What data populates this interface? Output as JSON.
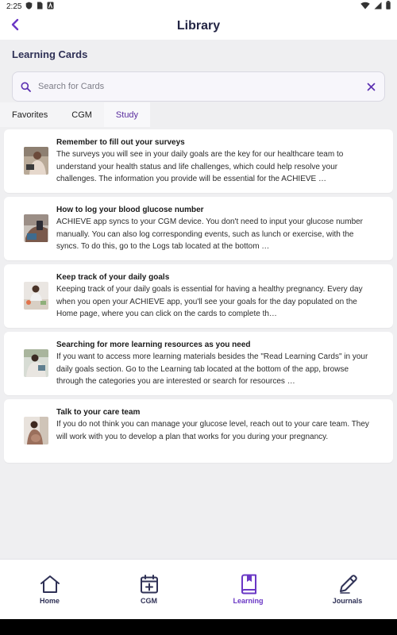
{
  "status_bar": {
    "time": "2:25"
  },
  "app_bar": {
    "title": "Library",
    "back_icon": "chevron-left-icon"
  },
  "section": {
    "title": "Learning Cards"
  },
  "search": {
    "placeholder": "Search for Cards",
    "value": ""
  },
  "tabs": [
    {
      "label": "Favorites"
    },
    {
      "label": "CGM"
    },
    {
      "label": "Study"
    }
  ],
  "cards": [
    {
      "title": "Remember to fill out your surveys",
      "description": "The surveys you will see in your daily goals are the key for our healthcare team to understand your health status and life challenges, which could help resolve your challenges. The information you provide will be essential for the ACHIEVE …"
    },
    {
      "title": "How to log your blood glucose number",
      "description": "ACHIEVE app syncs to your CGM device. You don't need to input your glucose number manually. You can also log corresponding events, such as lunch or exercise, with the syncs. To do this, go to the Logs tab located at the bottom …"
    },
    {
      "title": "Keep track of your daily goals",
      "description": "Keeping track of your daily goals is essential for having a healthy pregnancy. Every day when you open your ACHIEVE app, you'll see your goals for the day populated on the Home page, where you can click on the cards to complete th…"
    },
    {
      "title": "Searching for more learning resources as you need",
      "description": "If you want to access more learning materials besides the \"Read Learning Cards\" in your daily goals section. Go to the Learning tab located at the bottom of the app, browse through the categories you are interested or search for resources …"
    },
    {
      "title": "Talk to your care team",
      "description": "If you do not think you can manage your glucose level, reach out to your care team. They will work with you to develop a plan that works for you during your pregnancy."
    }
  ],
  "bottom_nav": [
    {
      "label": "Home",
      "icon": "home-icon"
    },
    {
      "label": "CGM",
      "icon": "calendar-plus-icon"
    },
    {
      "label": "Learning",
      "icon": "book-bookmark-icon"
    },
    {
      "label": "Journals",
      "icon": "pencil-icon"
    }
  ],
  "colors": {
    "accent": "#6a37c5",
    "title_text": "#232544",
    "background": "#efeff1"
  }
}
